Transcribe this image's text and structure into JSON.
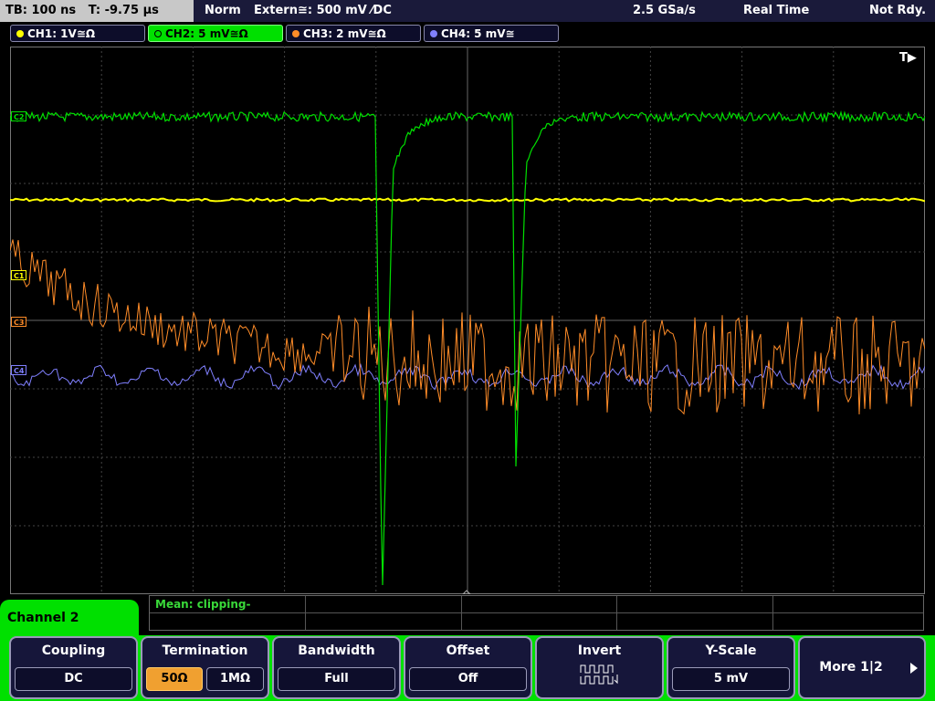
{
  "status_bar": {
    "timebase": "TB: 100 ns   T: -9.75 µs",
    "trigger_mode": "Norm",
    "trigger_source": "Extern≅: 500 mV ⁄DC",
    "sample_rate": "2.5 GSa/s",
    "acquisition_mode": "Real Time",
    "ready_state": "Not Rdy."
  },
  "channels": [
    {
      "label": "CH1: 1V≅Ω",
      "color": "#ffff00",
      "marker": "C1"
    },
    {
      "label": "CH2: 5 mV≅Ω",
      "color": "#00e000",
      "marker": "C2",
      "selected": true
    },
    {
      "label": "CH3: 2 mV≅Ω",
      "color": "#ff8c28",
      "marker": "C3"
    },
    {
      "label": "CH4: 5 mV≅",
      "color": "#8080ff",
      "marker": "C4"
    }
  ],
  "trigger_marker": "T▶",
  "measurement": {
    "text": "Mean: clipping-"
  },
  "menu": {
    "title": "Channel 2",
    "softkeys": [
      {
        "title": "Coupling",
        "values": [
          "DC"
        ]
      },
      {
        "title": "Termination",
        "values": [
          "50Ω",
          "1MΩ"
        ],
        "selected": "50Ω"
      },
      {
        "title": "Bandwidth",
        "values": [
          "Full"
        ]
      },
      {
        "title": "Offset",
        "values": [
          "Off"
        ]
      },
      {
        "title": "Invert",
        "icon": "invert-waveform-icon"
      },
      {
        "title": "Y-Scale",
        "values": [
          "5 mV"
        ]
      },
      {
        "title": "More 1|2",
        "icon": "arrow-right-icon"
      }
    ]
  }
}
